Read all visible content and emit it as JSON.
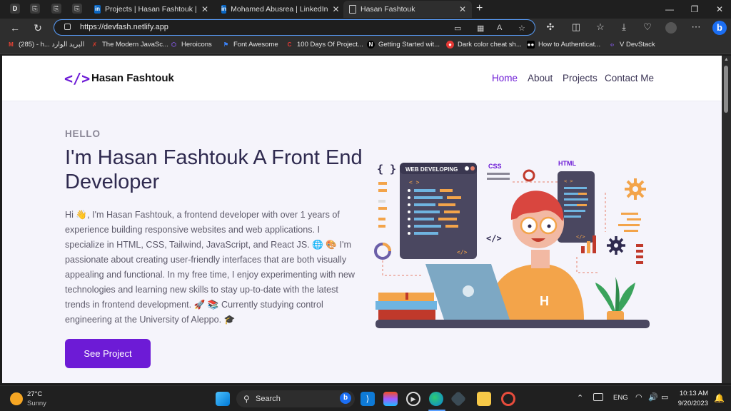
{
  "tabs": [
    {
      "label": "Projects | Hasan Fashtouk | LinkedIn"
    },
    {
      "label": "Mohamed Abusrea | LinkedIn"
    },
    {
      "label": "Hasan Fashtouk"
    }
  ],
  "address": {
    "url": "https://devfash.netlify.app"
  },
  "bookmarks": [
    {
      "label": "(285) - h... البريد الوارد",
      "icon": "gmail-icon",
      "color": "#ea4335"
    },
    {
      "label": "The Modern JavaSc...",
      "icon": "js-icon",
      "color": "#c0392b"
    },
    {
      "label": "Heroicons",
      "icon": "heroicons-icon",
      "color": "#8b5cf6"
    },
    {
      "label": "Font Awesome",
      "icon": "flag-icon",
      "color": "#3b82f6"
    },
    {
      "label": "100 Days Of Project...",
      "icon": "c-icon",
      "color": "#e53935"
    },
    {
      "label": "Getting Started wit...",
      "icon": "next-icon",
      "color": "#000000"
    },
    {
      "label": "Dark color cheat sh...",
      "icon": "palette-icon",
      "color": "#e53935"
    },
    {
      "label": "How to Authenticat...",
      "icon": "medium-icon",
      "color": "#000000"
    },
    {
      "label": "V DevStack",
      "icon": "code-icon",
      "color": "#8b5cf6"
    }
  ],
  "site": {
    "logo_code": "</>",
    "logo_name": "Hasan Fashtouk",
    "nav": [
      "Home",
      "About",
      "Projects",
      "Contact Me"
    ],
    "hello": "HELLO",
    "title": "I'm Hasan Fashtouk A Front End Developer",
    "bio": "Hi 👋, I'm Hasan Fashtouk, a frontend developer with over 1 years of experience building responsive websites and web applications. I specialize in HTML, CSS, Tailwind, JavaScript, and React JS. 🌐 🎨 I'm passionate about creating user-friendly interfaces that are both visually appealing and functional. In my free time, I enjoy experimenting with new technologies and learning new skills to stay up-to-date with the latest trends in frontend development. 🚀 📚 Currently studying control engineering at the University of Aleppo. 🎓",
    "cta": "See Project",
    "illustration": {
      "panel_label": "WEB DEVELOPING",
      "css_label": "CSS",
      "html_label": "HTML",
      "braces": "{ }",
      "code_tag": "</>",
      "shirt_letter": "H"
    }
  },
  "taskbar": {
    "weather_temp": "27°C",
    "weather_desc": "Sunny",
    "search_placeholder": "Search",
    "lang": "ENG",
    "time": "10:13 AM",
    "date": "9/20/2023"
  },
  "colors": {
    "accent": "#6d1bd6",
    "title": "#2f2a4f",
    "page_bg": "#f5f4fb"
  }
}
